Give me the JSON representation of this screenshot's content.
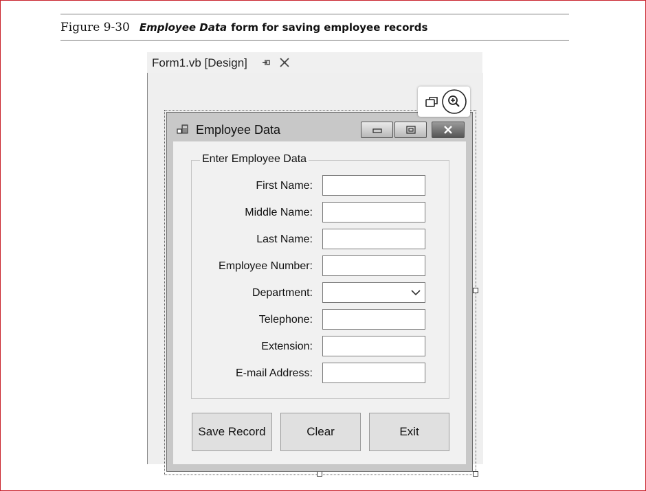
{
  "figure": {
    "number": "Figure 9-30",
    "title_italic": "Employee Data",
    "title_rest": "form for saving employee records"
  },
  "ide": {
    "tab_title": "Form1.vb [Design]",
    "pin_icon": "pin-icon",
    "close_icon": "close-icon"
  },
  "form": {
    "title": "Employee Data",
    "group_title": "Enter Employee Data",
    "fields": [
      {
        "label": "First Name:",
        "value": ""
      },
      {
        "label": "Middle Name:",
        "value": ""
      },
      {
        "label": "Last Name:",
        "value": ""
      },
      {
        "label": "Employee Number:",
        "value": ""
      },
      {
        "label": "Department:",
        "value": "",
        "type": "dropdown"
      },
      {
        "label": "Telephone:",
        "value": ""
      },
      {
        "label": "Extension:",
        "value": ""
      },
      {
        "label": "E-mail Address:",
        "value": ""
      }
    ],
    "buttons": {
      "save": "Save Record",
      "clear": "Clear",
      "exit": "Exit"
    }
  },
  "colors": {
    "caption_frame": "#c8202a",
    "form_background": "#f1f1f1"
  }
}
